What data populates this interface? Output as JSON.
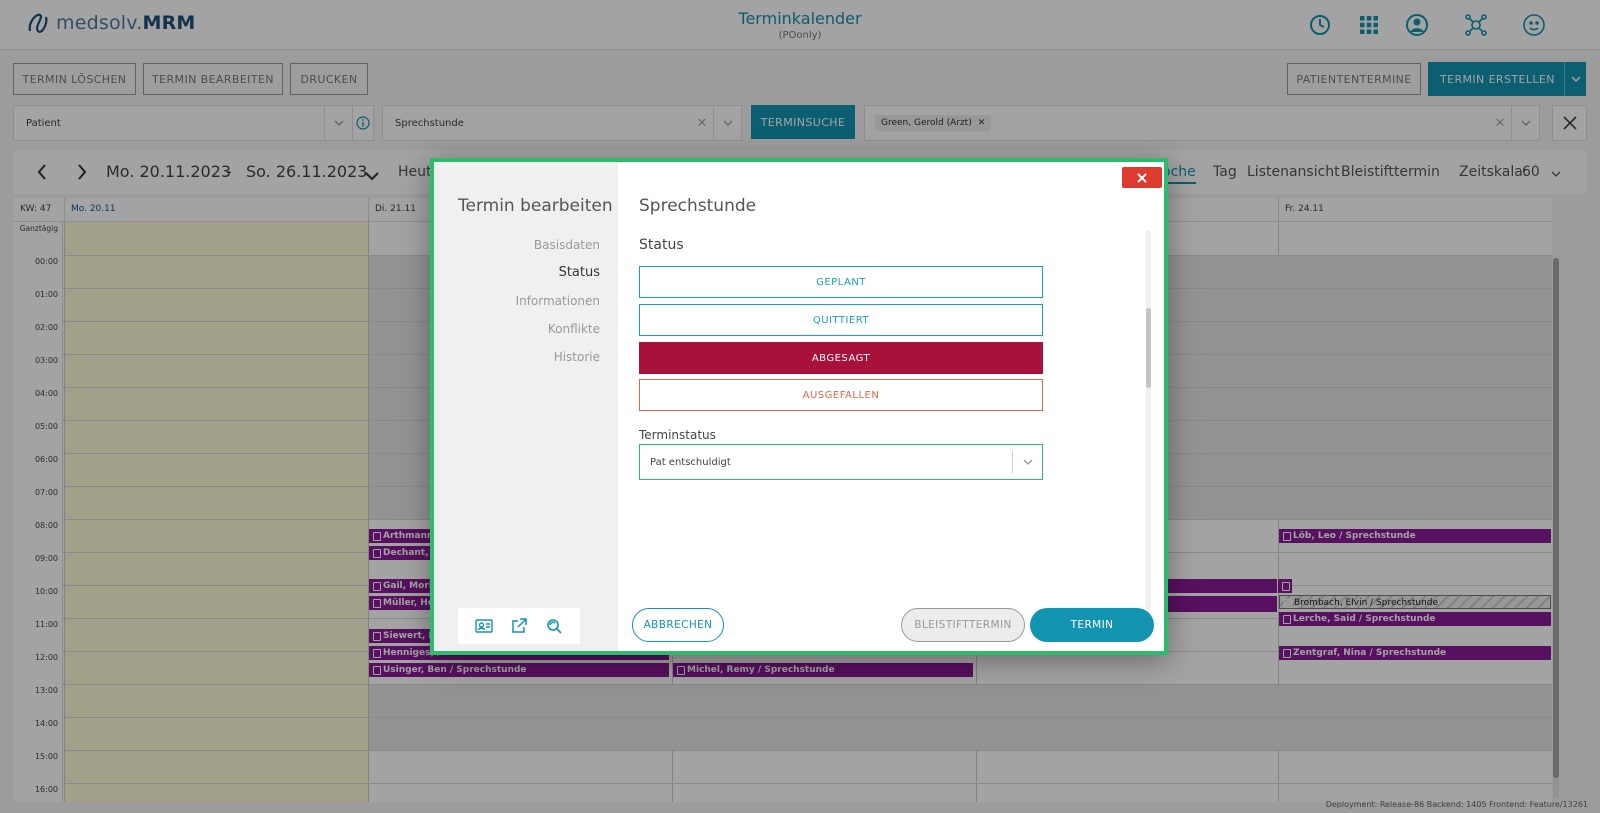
{
  "header": {
    "logo_prefix": "medsolv.",
    "logo_brand": "MRM",
    "title": "Terminkalender",
    "subtitle": "(POonly)",
    "icons": [
      "clock-icon",
      "apps-grid-icon",
      "user-profile-icon",
      "network-icon",
      "theater-masks-icon"
    ]
  },
  "toolbar": {
    "termin_loeschen": "TERMIN LÖSCHEN",
    "termin_bearbeiten": "TERMIN BEARBEITEN",
    "drucken": "DRUCKEN",
    "patiententermine": "PATIENTENTERMINE",
    "termin_erstellen": "TERMIN ERSTELLEN"
  },
  "filters": {
    "patient_placeholder": "Patient",
    "appointment_type": "Sprechstunde",
    "terminsuche": "TERMINSUCHE",
    "resource_tag": "Green, Gerold (Arzt)"
  },
  "calendar": {
    "date_from": "Mo. 20.11.2023",
    "date_sep": "-",
    "date_to": "So. 26.11.2023",
    "today": "Heute",
    "views": {
      "woche_partial": "oche",
      "tag": "Tag",
      "liste": "Listenansicht",
      "bleistift": "Bleistifttermin"
    },
    "zeitskala_label": "Zeitskala:",
    "zeitskala_value": "60",
    "kw": "KW: 47",
    "days": {
      "mo": "Mo. 20.11",
      "di": "Di. 21.11",
      "fr": "Fr. 24.11"
    },
    "allday": "Ganztägig",
    "hours": [
      "00:00",
      "01:00",
      "02:00",
      "03:00",
      "04:00",
      "05:00",
      "06:00",
      "07:00",
      "08:00",
      "09:00",
      "10:00",
      "11:00",
      "12:00",
      "13:00",
      "14:00",
      "15:00",
      "16:00"
    ],
    "appointments": {
      "a1": "Arthmann, ",
      "a2": "Dechant, M",
      "a3": "Gail, Morib",
      "a4": "Müller, Hei",
      "a5": "Siewert, H",
      "a6": "Henniges, /",
      "a7": "Usinger, Ben / Sprechstunde",
      "a8": "Michel, Remy / Sprechstunde",
      "a9": "Löb, Leo / Sprechstunde",
      "a10": "Brombach, Elvin / Sprechstunde",
      "a11": "Lerche, Said / Sprechstunde",
      "a12": "Zentgraf, Nina / Sprechstunde"
    }
  },
  "footer": "Deployment: Release-86   Backend: 1405   Frontend: Feature/13261",
  "dialog": {
    "title": "Termin bearbeiten",
    "nav": [
      "Basisdaten",
      "Status",
      "Informationen",
      "Konflikte",
      "Historie"
    ],
    "active_nav": "Status",
    "heading": "Sprechstunde",
    "section": "Status",
    "status_buttons": {
      "geplant": "GEPLANT",
      "quittiert": "QUITTIERT",
      "abgesagt": "ABGESAGT",
      "ausgefallen": "AUSGEFALLEN"
    },
    "selected_status": "ABGESAGT",
    "terminstatus_label": "Terminstatus",
    "terminstatus_value": "Pat entschuldigt",
    "abbrechen": "ABBRECHEN",
    "bleistifttermin": "BLEISTIFTTERMIN",
    "termin": "TERMIN",
    "tool_icons": [
      "contact-card-icon",
      "external-link-icon",
      "search-refresh-icon"
    ]
  },
  "colors": {
    "teal": "#1394b1",
    "appointment_purple": "#8a1a96",
    "abgesagt_red": "#a8113a",
    "dialog_border_green": "#2dbb6d",
    "close_red": "#dd3b2f"
  }
}
